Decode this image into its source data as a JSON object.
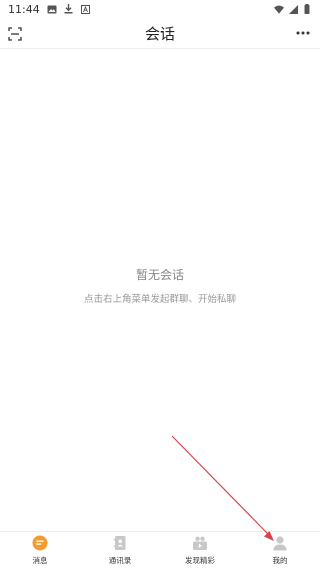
{
  "status_bar": {
    "time": "11:44"
  },
  "header": {
    "title": "会话"
  },
  "empty_state": {
    "title": "暂无会话",
    "hint": "点击右上角菜单发起群聊、开始私聊"
  },
  "tabs": [
    {
      "label": "消息",
      "icon": "message-icon",
      "active": true
    },
    {
      "label": "通讯录",
      "icon": "contacts-icon",
      "active": false
    },
    {
      "label": "发现精彩",
      "icon": "discover-icon",
      "active": false
    },
    {
      "label": "我的",
      "icon": "profile-icon",
      "active": false
    }
  ],
  "colors": {
    "accent": "#f39b2e",
    "inactive_icon": "#c8c8c8",
    "annotation_arrow": "#d9414d"
  }
}
